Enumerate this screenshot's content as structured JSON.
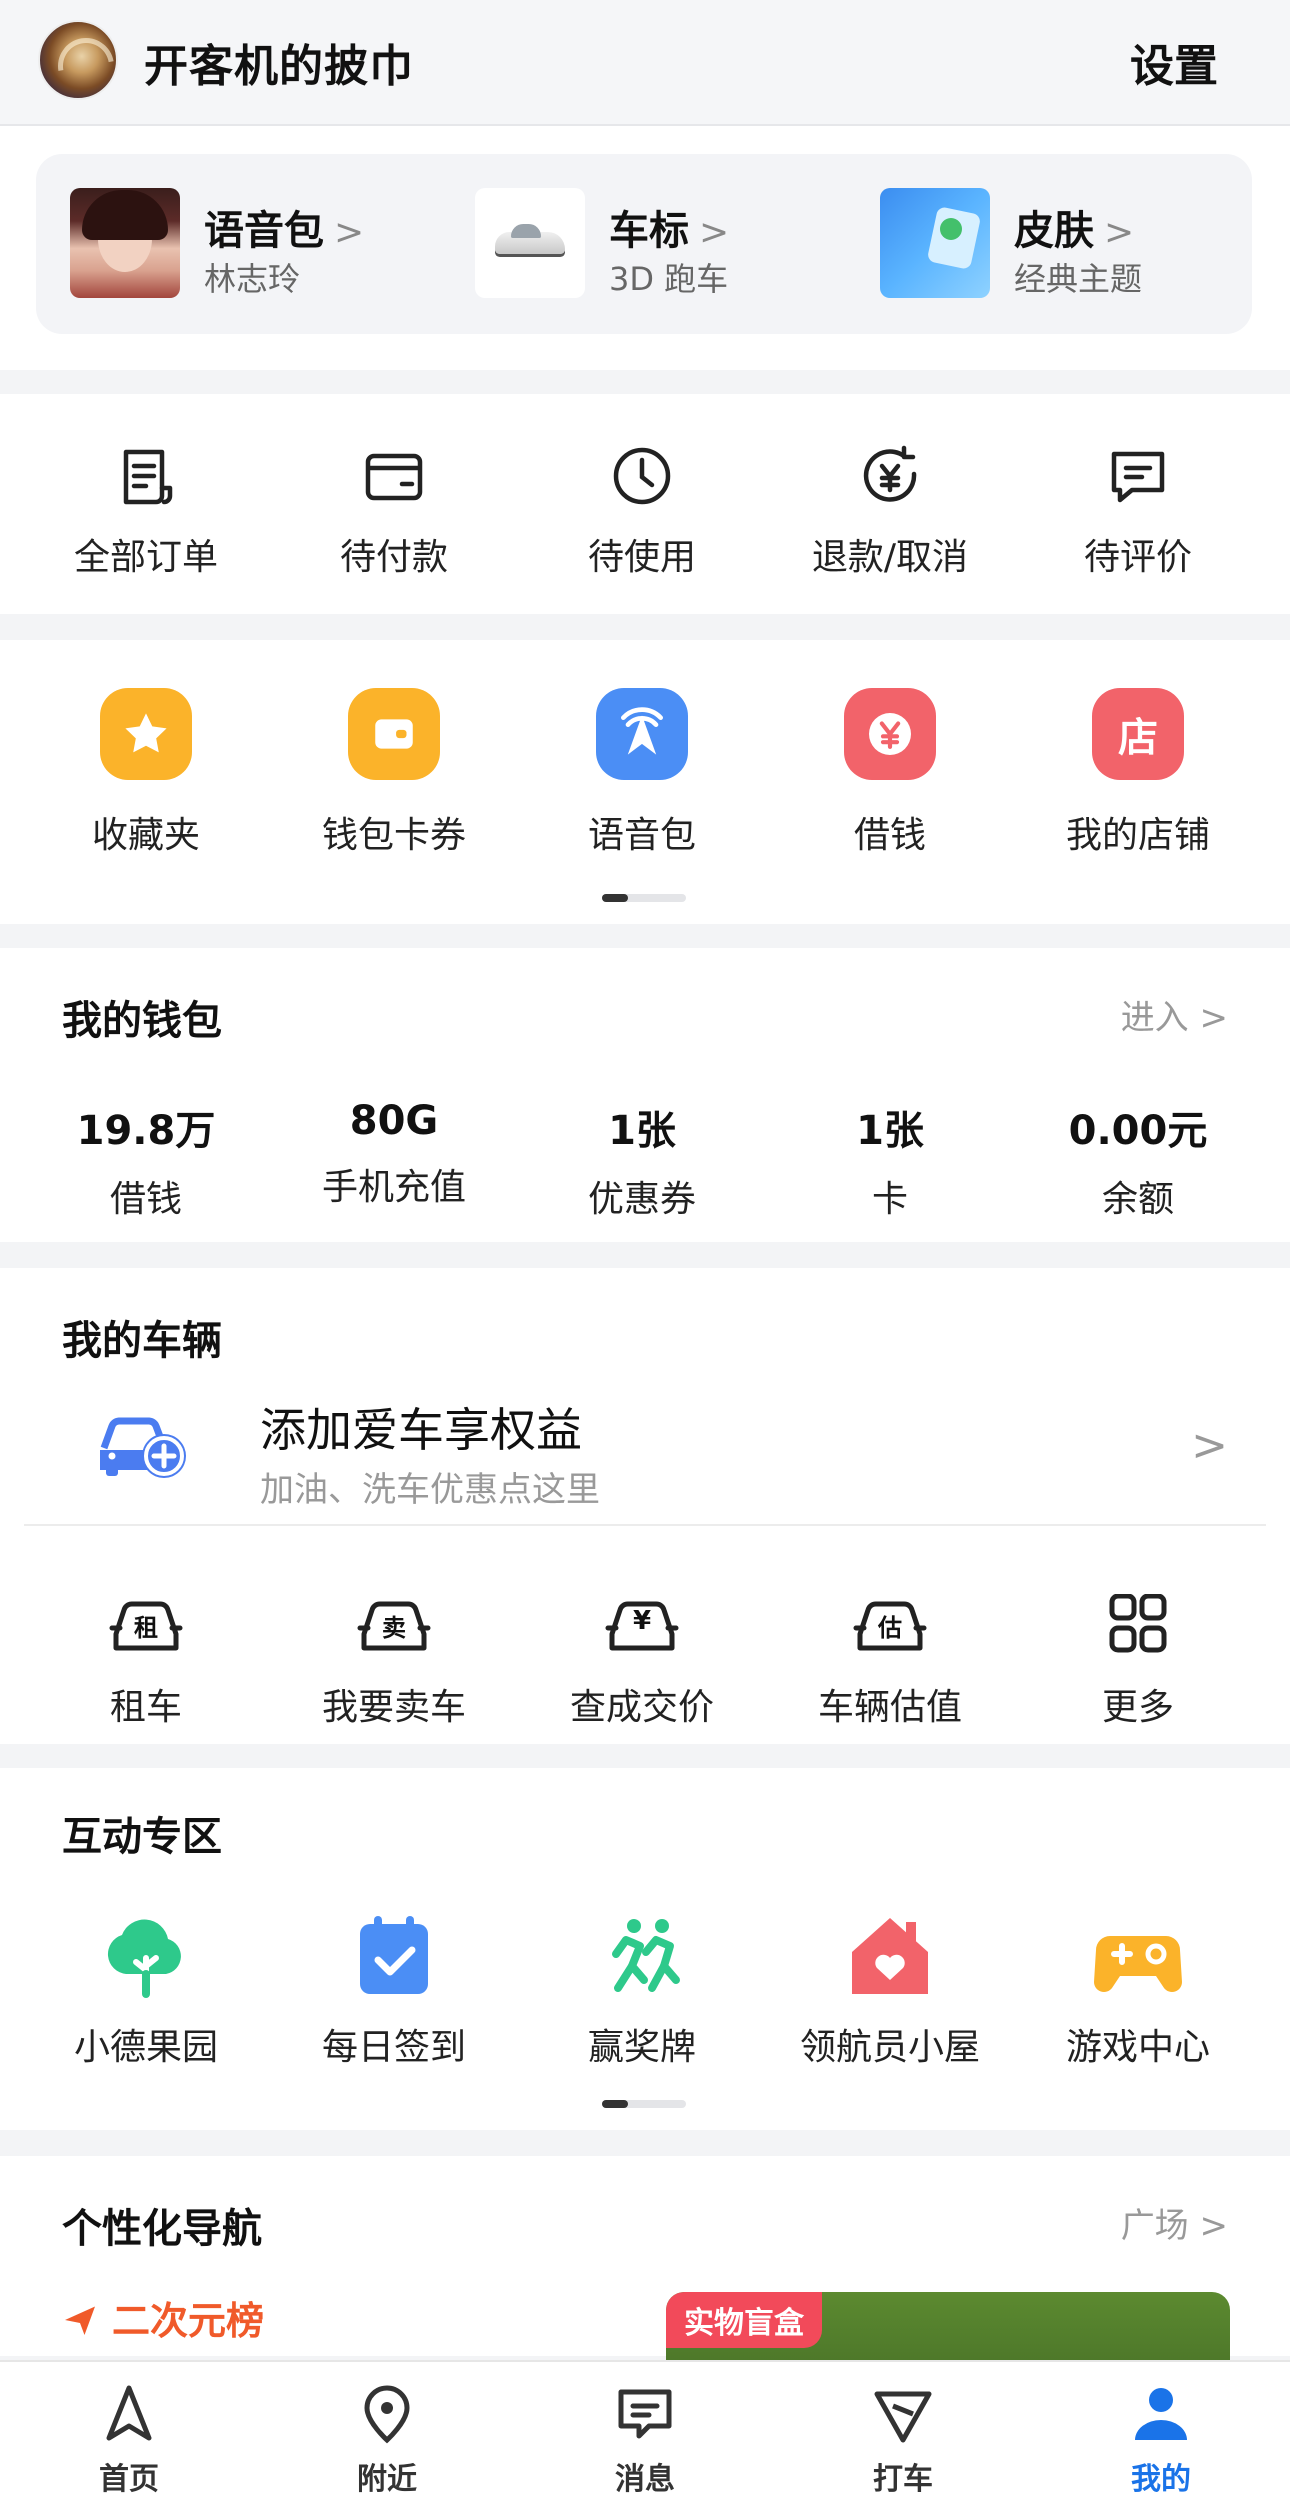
{
  "header": {
    "username": "开客机的披巾",
    "settings": "设置"
  },
  "personalization": [
    {
      "title": "语音包",
      "subtitle": "林志玲"
    },
    {
      "title": "车标",
      "subtitle": "3D 跑车"
    },
    {
      "title": "皮肤",
      "subtitle": "经典主题"
    }
  ],
  "chevron": ">",
  "orders": [
    {
      "label": "全部订单",
      "icon": "order-list-icon"
    },
    {
      "label": "待付款",
      "icon": "wallet-card-icon"
    },
    {
      "label": "待使用",
      "icon": "clock-icon"
    },
    {
      "label": "退款/取消",
      "icon": "refund-icon"
    },
    {
      "label": "待评价",
      "icon": "comment-icon"
    }
  ],
  "services": [
    {
      "label": "收藏夹",
      "icon": "star-icon",
      "glyph": "★",
      "color": "#fbb32a"
    },
    {
      "label": "钱包卡券",
      "icon": "wallet-icon",
      "glyph": "▭",
      "color": "#fbb32a"
    },
    {
      "label": "语音包",
      "icon": "voice-icon",
      "glyph": "A",
      "color": "#4b8ef5"
    },
    {
      "label": "借钱",
      "icon": "yen-icon",
      "glyph": "¥",
      "color": "#f2636a"
    },
    {
      "label": "我的店铺",
      "icon": "store-icon",
      "glyph": "店",
      "color": "#f2636a"
    }
  ],
  "wallet": {
    "title": "我的钱包",
    "link": "进入",
    "items": [
      {
        "value": "19.8万",
        "label": "借钱"
      },
      {
        "value": "80G",
        "label": "手机充值"
      },
      {
        "value": "1张",
        "label": "优惠券"
      },
      {
        "value": "1张",
        "label": "卡"
      },
      {
        "value": "0.00元",
        "label": "余额"
      }
    ]
  },
  "vehicle": {
    "title": "我的车辆",
    "add_title": "添加爱车享权益",
    "add_sub": "加油、洗车优惠点这里",
    "items": [
      {
        "label": "租车",
        "glyph": "租",
        "icon": "rent-car-icon"
      },
      {
        "label": "我要卖车",
        "glyph": "卖",
        "icon": "sell-car-icon"
      },
      {
        "label": "查成交价",
        "glyph": "¥",
        "icon": "price-car-icon"
      },
      {
        "label": "车辆估值",
        "glyph": "估",
        "icon": "valuation-car-icon"
      },
      {
        "label": "更多",
        "glyph": "",
        "icon": "more-grid-icon"
      }
    ]
  },
  "interact": {
    "title": "互动专区",
    "items": [
      {
        "label": "小德果园",
        "icon": "tree-icon",
        "color": "#2ec98b"
      },
      {
        "label": "每日签到",
        "icon": "calendar-check-icon",
        "color": "#4b8ef5"
      },
      {
        "label": "赢奖牌",
        "icon": "runner-icon",
        "color": "#2ec98b"
      },
      {
        "label": "领航员小屋",
        "icon": "house-heart-icon",
        "color": "#f2636a"
      },
      {
        "label": "游戏中心",
        "icon": "gamepad-icon",
        "color": "#fbb32a"
      }
    ]
  },
  "pnav": {
    "title": "个性化导航",
    "link": "广场",
    "rank": "二次元榜",
    "banner_tag": "实物盲盒"
  },
  "tabbar": [
    {
      "label": "首页",
      "icon": "navigate-arrow-icon"
    },
    {
      "label": "附近",
      "icon": "location-pin-icon"
    },
    {
      "label": "消息",
      "icon": "message-icon"
    },
    {
      "label": "打车",
      "icon": "taxi-flag-icon"
    },
    {
      "label": "我的",
      "icon": "user-icon",
      "active": true
    }
  ],
  "colors": {
    "accent": "#1a73e8",
    "rank": "#f05a2a"
  }
}
